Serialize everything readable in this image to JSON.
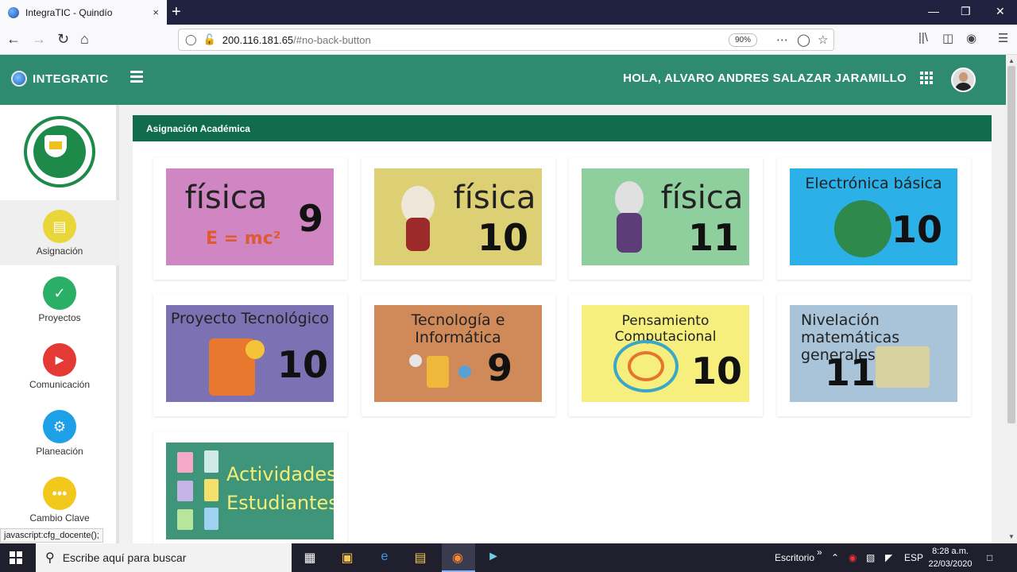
{
  "browser": {
    "tab_title": "IntegraTIC - Quindío",
    "tab_close": "×",
    "new_tab": "+",
    "url_host": "200.116.181.65",
    "url_path": "/#no-back-button",
    "zoom": "90%",
    "status_tip": "javascript:cfg_docente();"
  },
  "header": {
    "brand": "INTEGRATIC",
    "greeting": "HOLA, ALVARO ANDRES SALAZAR JARAMILLO"
  },
  "sidebar": {
    "items": [
      {
        "label": "Asignación",
        "color": "#e8d63a"
      },
      {
        "label": "Proyectos",
        "color": "#2bae66"
      },
      {
        "label": "Comunicación",
        "color": "#e53935"
      },
      {
        "label": "Planeación",
        "color": "#1ea0e8"
      },
      {
        "label": "Cambio Clave",
        "color": "#f2c81c"
      }
    ]
  },
  "panel": {
    "title": "Asignación Académica"
  },
  "courses": [
    {
      "title": "física",
      "number": "9",
      "extra": "E = mc²",
      "bg": "#cf86c2"
    },
    {
      "title": "física",
      "number": "10",
      "bg": "#dccf74"
    },
    {
      "title": "física",
      "number": "11",
      "bg": "#8fcf9e"
    },
    {
      "title": "Electrónica básica",
      "number": "10",
      "bg": "#2bb0e8"
    },
    {
      "title": "Proyecto Tecnológico",
      "number": "10",
      "bg": "#7c71b3"
    },
    {
      "title": "Tecnología e Informática",
      "number": "9",
      "bg": "#d08a5a"
    },
    {
      "title": "Pensamiento Computacional",
      "number": "10",
      "bg": "#f6ef7e"
    },
    {
      "title": "Nivelación matemáticas generales",
      "number": "11",
      "bg": "#a9c4d9"
    },
    {
      "title": "Actividades Estudiantes",
      "number": "",
      "bg": "#3f9579"
    }
  ],
  "taskbar": {
    "search_placeholder": "Escribe aquí para buscar",
    "desktop_label": "Escritorio",
    "language": "ESP",
    "time": "8:28 a.m.",
    "date": "22/03/2020"
  }
}
